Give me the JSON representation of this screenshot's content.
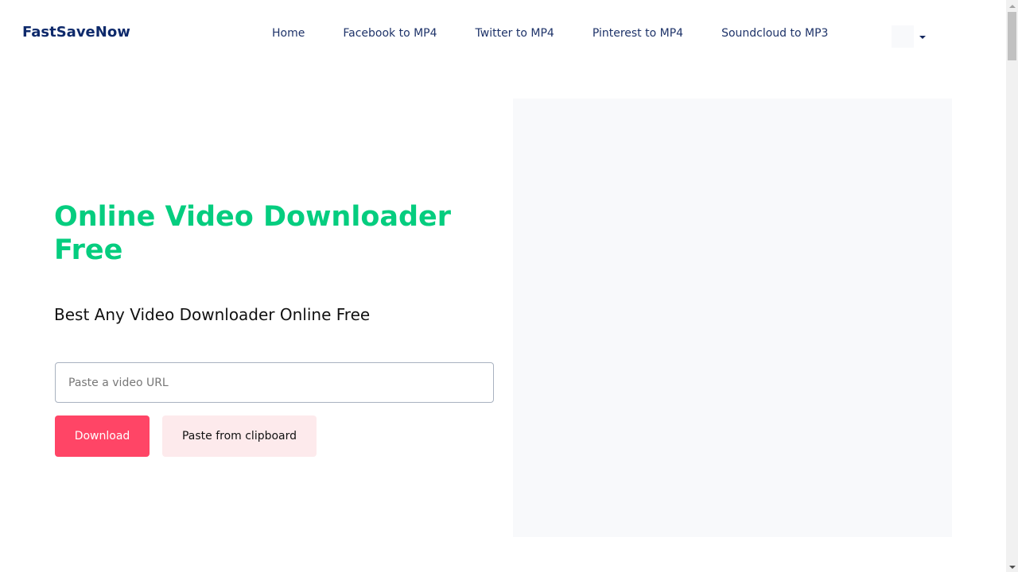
{
  "header": {
    "logo": "FastSaveNow",
    "nav": [
      {
        "label": "Home"
      },
      {
        "label": "Facebook to MP4"
      },
      {
        "label": "Twitter to MP4"
      },
      {
        "label": "Pinterest to MP4"
      },
      {
        "label": "Soundcloud to MP3"
      }
    ],
    "language_selector": {
      "icon": "flag-icon",
      "caret": "chevron-down-icon"
    }
  },
  "hero": {
    "title": "Online Video Downloader Free",
    "subtitle": "Best Any Video Downloader Online Free",
    "url_input": {
      "value": "",
      "placeholder": "Paste a video URL"
    },
    "download_label": "Download",
    "paste_label": "Paste from clipboard"
  },
  "colors": {
    "brand": "#0e2a6b",
    "title_green": "#05cd7f",
    "download_button": "#ff4566",
    "paste_button": "#fdeaec",
    "panel_bg": "#f8f9fb"
  }
}
